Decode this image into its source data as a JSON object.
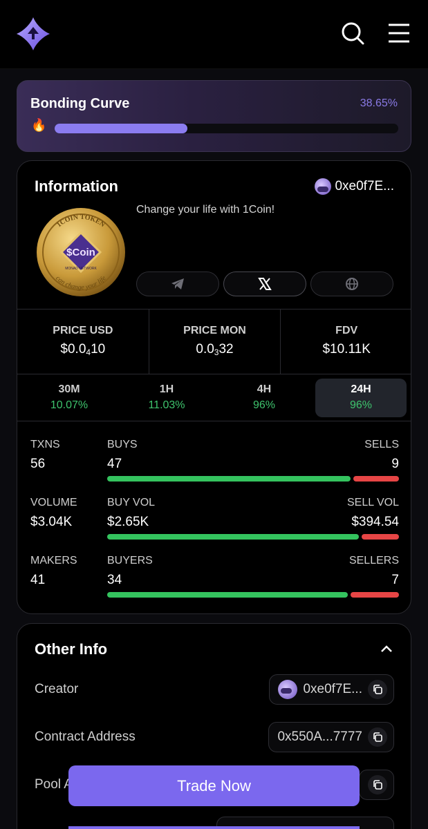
{
  "header": {
    "logo": "app-logo",
    "search_icon": "search-icon",
    "menu_icon": "hamburger-menu-icon"
  },
  "bonding": {
    "title": "Bonding Curve",
    "percent_text": "38.65%",
    "progress": 0.3865,
    "fire_icon": "🔥"
  },
  "info": {
    "title": "Information",
    "creator_short": "0xe0f7E...",
    "description": "Change your life with 1Coin!",
    "coin": {
      "top_text": "1COIN TOKEN",
      "center_text": "$Coin",
      "network_text": "MONAD NETWORK",
      "bottom_text": "can change your life"
    },
    "socials": [
      "telegram-icon",
      "x-icon",
      "globe-icon"
    ],
    "stats": [
      {
        "label": "PRICE USD",
        "value_pre": "$0.0",
        "value_sub": "4",
        "value_post": "10"
      },
      {
        "label": "PRICE MON",
        "value_pre": "0.0",
        "value_sub": "3",
        "value_post": "32"
      },
      {
        "label": "FDV",
        "value_pre": "$10.11K",
        "value_sub": "",
        "value_post": ""
      }
    ],
    "timeframes": [
      {
        "label": "30M",
        "value": "10.07%"
      },
      {
        "label": "1H",
        "value": "11.03%"
      },
      {
        "label": "4H",
        "value": "96%"
      },
      {
        "label": "24H",
        "value": "96%",
        "active": true
      }
    ],
    "trades": [
      {
        "l1": "TXNS",
        "v1": "56",
        "l2": "BUYS",
        "v2": "47",
        "l3": "SELLS",
        "v3": "9",
        "buy": 47,
        "sell": 9
      },
      {
        "l1": "VOLUME",
        "v1": "$3.04K",
        "l2": "BUY VOL",
        "v2": "$2.65K",
        "l3": "SELL VOL",
        "v3": "$394.54",
        "buy": 2650,
        "sell": 394.54
      },
      {
        "l1": "MAKERS",
        "v1": "41",
        "l2": "BUYERS",
        "v2": "34",
        "l3": "SELLERS",
        "v3": "7",
        "buy": 34,
        "sell": 7
      }
    ],
    "colors": {
      "buy": "#34c35e",
      "sell": "#e64545",
      "accent": "#7b68ee"
    }
  },
  "other": {
    "title": "Other Info",
    "rows": [
      {
        "label": "Creator",
        "value": "0xe0f7E..."
      },
      {
        "label": "Contract Address",
        "value": "0x550A...7777"
      },
      {
        "label": "Pool Address",
        "value": ""
      }
    ]
  },
  "trade_button": "Trade Now"
}
